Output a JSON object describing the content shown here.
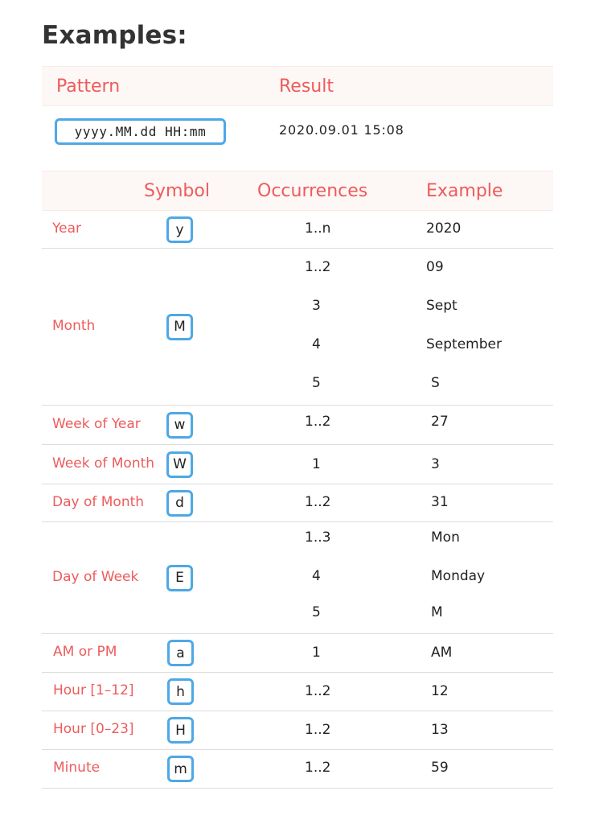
{
  "title": "Examples:",
  "pattern_table": {
    "headers": [
      "Pattern",
      "Result"
    ],
    "pattern": "yyyy.MM.dd HH:mm",
    "result": "2020.09.01 15:08"
  },
  "symbol_table": {
    "headers": [
      "Symbol",
      "Occurrences",
      "Example"
    ],
    "rows": [
      {
        "name": "Year",
        "symbol": "y",
        "entries": [
          {
            "occ": "1..n",
            "ex": "2020"
          }
        ]
      },
      {
        "name": "Month",
        "symbol": "M",
        "entries": [
          {
            "occ": "1..2",
            "ex": "09"
          },
          {
            "occ": "3",
            "ex": "Sept"
          },
          {
            "occ": "4",
            "ex": "September"
          },
          {
            "occ": "5",
            "ex": "S"
          }
        ]
      },
      {
        "name": "Week of Year",
        "symbol": "w",
        "entries": [
          {
            "occ": "1..2",
            "ex": "27"
          }
        ]
      },
      {
        "name": "Week of Month",
        "symbol": "W",
        "entries": [
          {
            "occ": "1",
            "ex": "3"
          }
        ]
      },
      {
        "name": "Day of Month",
        "symbol": "d",
        "entries": [
          {
            "occ": "1..2",
            "ex": "31"
          }
        ]
      },
      {
        "name": "Day of Week",
        "symbol": "E",
        "entries": [
          {
            "occ": "1..3",
            "ex": "Mon"
          },
          {
            "occ": "4",
            "ex": "Monday"
          },
          {
            "occ": "5",
            "ex": "M"
          }
        ]
      },
      {
        "name": "AM or PM",
        "symbol": "a",
        "entries": [
          {
            "occ": "1",
            "ex": "AM"
          }
        ]
      },
      {
        "name": "Hour [1–12]",
        "symbol": "h",
        "entries": [
          {
            "occ": "1..2",
            "ex": "12"
          }
        ]
      },
      {
        "name": "Hour [0–23]",
        "symbol": "H",
        "entries": [
          {
            "occ": "1..2",
            "ex": "13"
          }
        ]
      },
      {
        "name": "Minute",
        "symbol": "m",
        "entries": [
          {
            "occ": "1..2",
            "ex": "59"
          }
        ]
      }
    ]
  }
}
